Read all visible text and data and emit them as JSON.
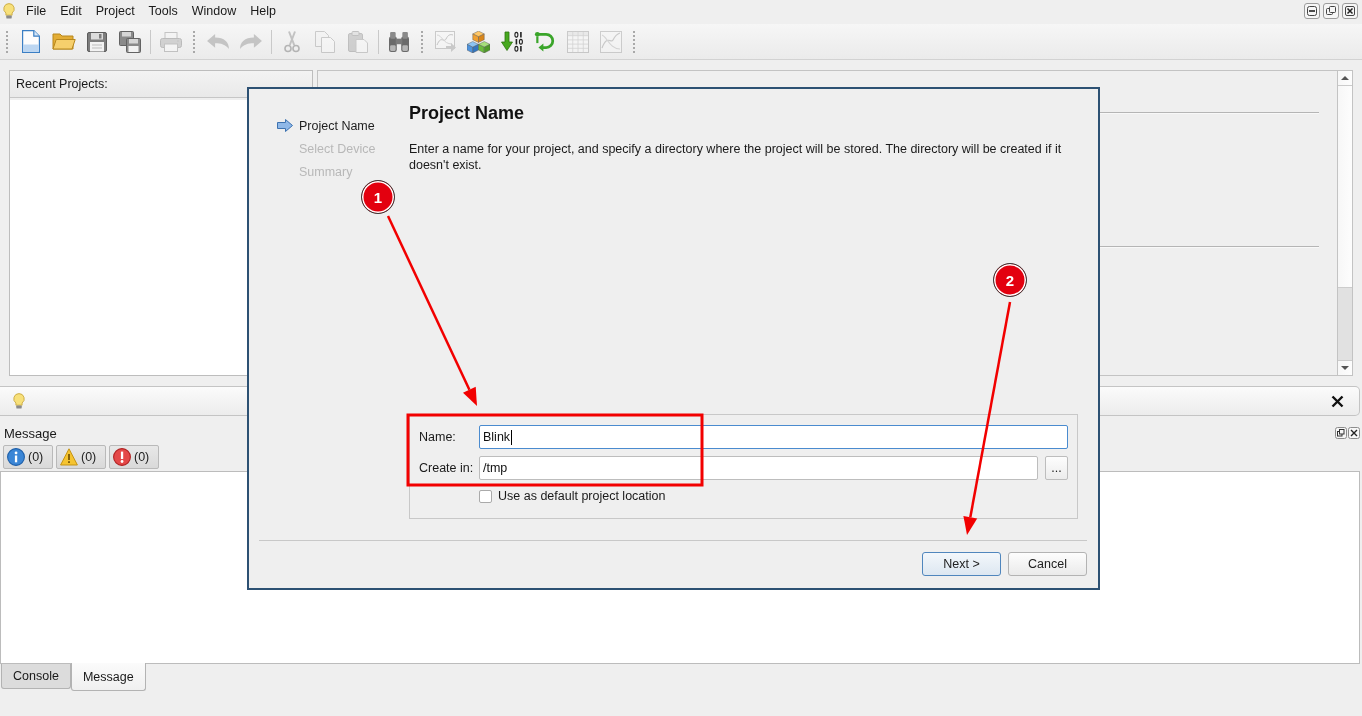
{
  "menu_bar": {
    "items": [
      "File",
      "Edit",
      "Project",
      "Tools",
      "Window",
      "Help"
    ]
  },
  "toolbars": [
    {
      "groups": [
        [
          {
            "kind": "new",
            "disabled": false
          },
          {
            "kind": "open",
            "disabled": false
          },
          {
            "kind": "save",
            "disabled": false
          },
          {
            "kind": "saveall",
            "disabled": false
          }
        ],
        [
          {
            "kind": "print",
            "disabled": true
          }
        ]
      ]
    },
    {
      "groups": [
        [
          {
            "kind": "undo",
            "disabled": true
          },
          {
            "kind": "redo",
            "disabled": true
          }
        ],
        [
          {
            "kind": "cut",
            "disabled": true
          },
          {
            "kind": "copy",
            "disabled": true
          },
          {
            "kind": "paste",
            "disabled": true
          }
        ],
        [
          {
            "kind": "find",
            "disabled": false
          }
        ]
      ]
    },
    {
      "groups": [
        [
          {
            "kind": "export",
            "disabled": true
          },
          {
            "kind": "build",
            "disabled": false
          },
          {
            "kind": "upload",
            "disabled": false
          },
          {
            "kind": "loop",
            "disabled": false
          },
          {
            "kind": "table",
            "disabled": true
          },
          {
            "kind": "plot",
            "disabled": true
          }
        ]
      ]
    }
  ],
  "recent_projects": {
    "title": "Recent Projects:"
  },
  "message_panel": {
    "title": "Message",
    "filters": [
      {
        "kind": "info",
        "count": "(0)"
      },
      {
        "kind": "warning",
        "count": "(0)"
      },
      {
        "kind": "error",
        "count": "(0)"
      }
    ]
  },
  "bottom_tabs": [
    {
      "label": "Console",
      "selected": false
    },
    {
      "label": "Message",
      "selected": true
    }
  ],
  "dialog": {
    "steps": [
      {
        "label": "Project Name",
        "selected": true
      },
      {
        "label": "Select Device",
        "selected": false
      },
      {
        "label": "Summary",
        "selected": false
      }
    ],
    "title": "Project Name",
    "description": "Enter a name for your project, and specify a directory where the project will be stored. The directory will be created if it doesn't exist.",
    "fields": [
      {
        "label": "Name:",
        "value": "Blink",
        "focused": true
      },
      {
        "label": "Create in:",
        "value": "/tmp",
        "focused": false,
        "browse_label": "..."
      }
    ],
    "default_location": {
      "label": "Use as default project location",
      "checked": false
    },
    "buttons": [
      {
        "label": "Next >",
        "default": true
      },
      {
        "label": "Cancel",
        "default": false
      }
    ]
  },
  "annotations": {
    "callouts": [
      {
        "label": "1"
      },
      {
        "label": "2"
      }
    ]
  }
}
